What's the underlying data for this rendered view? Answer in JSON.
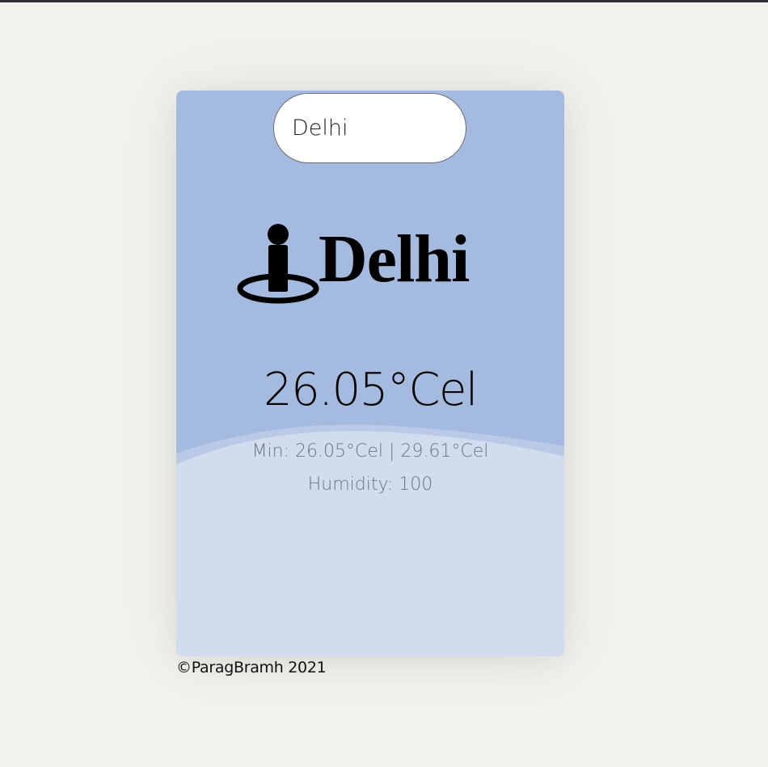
{
  "search": {
    "value": "Delhi"
  },
  "weather": {
    "city": "Delhi",
    "temperature": "26.05°Cel",
    "minmax": "Min: 26.05°Cel | 29.61°Cel",
    "humidity": "Humidity: 100"
  },
  "icons": {
    "location": "street-view-icon"
  },
  "footer": {
    "copyright": "©ParagBramh 2021"
  },
  "colors": {
    "page_background": "#f2f1ee",
    "card_top": "#a5badf",
    "card_bottom": "#d1ddef",
    "secondary_text": "#6f7480"
  }
}
